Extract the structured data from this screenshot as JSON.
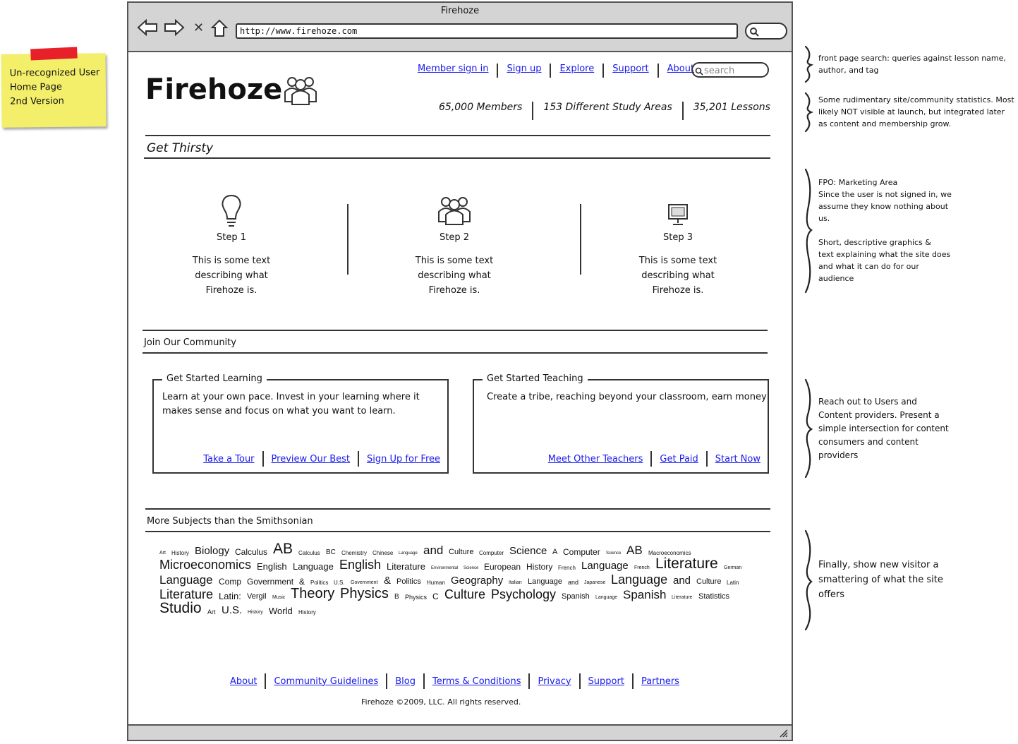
{
  "sticky_note": {
    "lines": [
      "Un-recognized User",
      "Home Page",
      "2nd Version"
    ]
  },
  "browser": {
    "title": "Firehoze",
    "url": "http://www.firehoze.com",
    "icons": [
      "back-arrow-icon",
      "forward-arrow-icon",
      "close-x-icon",
      "home-icon",
      "search-icon"
    ]
  },
  "header": {
    "logo": "Firehoze",
    "nav": [
      "Member sign in",
      "Sign up",
      "Explore",
      "Support",
      "About"
    ],
    "search_placeholder": "search",
    "stats": [
      "65,000 Members",
      "153 Different Study Areas",
      "35,201 Lessons"
    ]
  },
  "get_thirsty": {
    "title": "Get Thirsty",
    "steps": [
      {
        "icon": "lightbulb-icon",
        "label": "Step 1",
        "text": [
          "This is some text",
          "describing what",
          "Firehoze is."
        ]
      },
      {
        "icon": "people-icon",
        "label": "Step 2",
        "text": [
          "This is some text",
          "describing what",
          "Firehoze is."
        ]
      },
      {
        "icon": "computer-icon",
        "label": "Step 3",
        "text": [
          "This is some text",
          "describing what",
          "Firehoze is."
        ]
      }
    ]
  },
  "community": {
    "title": "Join Our Community",
    "learning": {
      "legend": "Get Started Learning",
      "text": [
        "Learn at your own pace. Invest in your learning where it",
        "makes sense and focus on what you want to learn."
      ],
      "links": [
        "Take a Tour",
        "Preview Our Best",
        "Sign Up for Free"
      ]
    },
    "teaching": {
      "legend": "Get Started Teaching",
      "text": [
        "Create a tribe, reaching beyond your classroom, earn money"
      ],
      "links": [
        "Meet Other Teachers",
        "Get Paid",
        "Start Now"
      ]
    }
  },
  "subjects": {
    "title": "More Subjects than the Smithsonian",
    "tags": [
      {
        "t": "Art",
        "s": 7
      },
      {
        "t": "History",
        "s": 8
      },
      {
        "t": "Biology",
        "s": 15
      },
      {
        "t": "Calculus",
        "s": 12
      },
      {
        "t": "AB",
        "s": 21
      },
      {
        "t": "Calculus",
        "s": 8
      },
      {
        "t": "BC",
        "s": 10
      },
      {
        "t": "Chemistry",
        "s": 8
      },
      {
        "t": "Chinese",
        "s": 8
      },
      {
        "t": "Language",
        "s": 6
      },
      {
        "t": "and",
        "s": 17
      },
      {
        "t": "Culture",
        "s": 11
      },
      {
        "t": "Computer",
        "s": 8
      },
      {
        "t": "Science",
        "s": 15
      },
      {
        "t": "A",
        "s": 11
      },
      {
        "t": "Computer",
        "s": 12
      },
      {
        "t": "Science",
        "s": 6
      },
      {
        "t": "AB",
        "s": 17
      },
      {
        "t": "Macroeconomics",
        "s": 8
      },
      {
        "t": "Microeconomics",
        "s": 18
      },
      {
        "t": "English",
        "s": 13
      },
      {
        "t": "Language",
        "s": 13
      },
      {
        "t": "English",
        "s": 18
      },
      {
        "t": "Literature",
        "s": 13
      },
      {
        "t": "Environmental",
        "s": 6
      },
      {
        "t": "Science",
        "s": 6
      },
      {
        "t": "European",
        "s": 12
      },
      {
        "t": "History",
        "s": 12
      },
      {
        "t": "French",
        "s": 8
      },
      {
        "t": "Language",
        "s": 15
      },
      {
        "t": "French",
        "s": 7
      },
      {
        "t": "Literature",
        "s": 21
      },
      {
        "t": "German",
        "s": 7
      },
      {
        "t": "Language",
        "s": 17
      },
      {
        "t": "Comp",
        "s": 12
      },
      {
        "t": "Government",
        "s": 12
      },
      {
        "t": "&",
        "s": 12
      },
      {
        "t": "Politics",
        "s": 8
      },
      {
        "t": "U.S.",
        "s": 8
      },
      {
        "t": "Government",
        "s": 7
      },
      {
        "t": "&",
        "s": 15
      },
      {
        "t": "Politics",
        "s": 11
      },
      {
        "t": "Human",
        "s": 8
      },
      {
        "t": "Geography",
        "s": 15
      },
      {
        "t": "Italian",
        "s": 7
      },
      {
        "t": "Language",
        "s": 11
      },
      {
        "t": "and",
        "s": 9
      },
      {
        "t": "Japanese",
        "s": 7
      },
      {
        "t": "Language",
        "s": 18
      },
      {
        "t": "and",
        "s": 15
      },
      {
        "t": "Culture",
        "s": 11
      },
      {
        "t": "Latin",
        "s": 8
      },
      {
        "t": "Literature",
        "s": 18
      },
      {
        "t": "Latin:",
        "s": 13
      },
      {
        "t": "Vergil",
        "s": 11
      },
      {
        "t": "Music",
        "s": 7
      },
      {
        "t": "Theory",
        "s": 20
      },
      {
        "t": "Physics",
        "s": 20
      },
      {
        "t": "B",
        "s": 10
      },
      {
        "t": "Physics",
        "s": 9
      },
      {
        "t": "C",
        "s": 12
      },
      {
        "t": "Culture",
        "s": 18
      },
      {
        "t": "Psychology",
        "s": 18
      },
      {
        "t": "Spanish",
        "s": 11
      },
      {
        "t": "Language",
        "s": 7
      },
      {
        "t": "Spanish",
        "s": 17
      },
      {
        "t": "Literature",
        "s": 7
      },
      {
        "t": "Statistics",
        "s": 11
      },
      {
        "t": "Studio",
        "s": 21
      },
      {
        "t": "Art",
        "s": 9
      },
      {
        "t": "U.S.",
        "s": 15
      },
      {
        "t": "History",
        "s": 7
      },
      {
        "t": "World",
        "s": 13
      },
      {
        "t": "History",
        "s": 8
      }
    ]
  },
  "footer": {
    "links": [
      "About",
      "Community Guidelines",
      "Blog",
      "Terms & Conditions",
      "Privacy",
      "Support",
      "Partners"
    ],
    "copyright": "Firehoze ©2009, LLC. All rights reserved."
  },
  "annotations": [
    [
      "front page search: queries against lesson name,",
      "author, and tag"
    ],
    [
      "Some rudimentary site/community statistics. Most",
      "likely NOT visible at launch, but integrated later",
      "as content and membership grow."
    ],
    [
      "FPO: Marketing Area",
      "Since the user is not signed in, we",
      "assume they know nothing about",
      "us.",
      "",
      "Short, descriptive graphics &",
      "text explaining what the site does",
      "and what it can do for our",
      "audience"
    ],
    [
      "Reach out to Users and",
      "Content providers.  Present a",
      "simple intersection for content",
      "consumers and content",
      "providers"
    ],
    [
      "Finally, show new visitor a",
      "smattering of what the site",
      "offers"
    ]
  ]
}
